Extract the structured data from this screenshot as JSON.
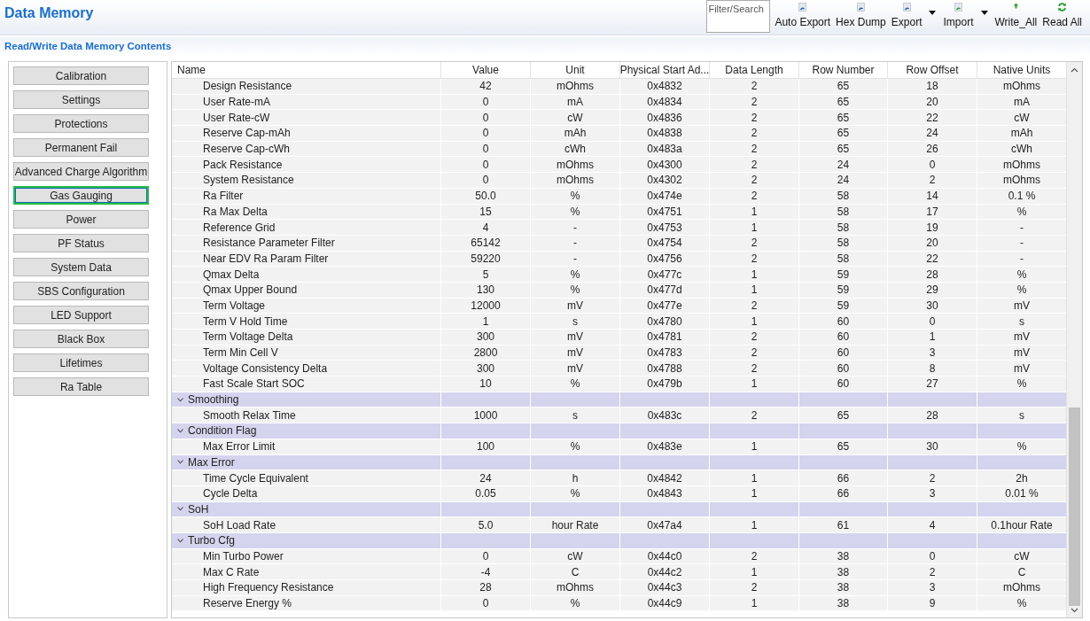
{
  "window": {
    "title": "Data Memory"
  },
  "toolbar": {
    "search": {
      "placeholder": "Filter/Search"
    },
    "buttons": [
      {
        "label": "Auto Export",
        "dropdown": false
      },
      {
        "label": "Hex Dump",
        "dropdown": false
      },
      {
        "label": "Export",
        "dropdown": true
      },
      {
        "label": "Import",
        "dropdown": true
      },
      {
        "label": "Write_All",
        "dropdown": false
      },
      {
        "label": "Read All",
        "dropdown": false
      }
    ]
  },
  "section_title": "Read/Write Data Memory Contents",
  "sidebar": {
    "items": [
      {
        "label": "Calibration",
        "selected": false
      },
      {
        "label": "Settings",
        "selected": false
      },
      {
        "label": "Protections",
        "selected": false
      },
      {
        "label": "Permanent Fail",
        "selected": false
      },
      {
        "label": "Advanced Charge Algorithm",
        "selected": false
      },
      {
        "label": "Gas Gauging",
        "selected": true
      },
      {
        "label": "Power",
        "selected": false
      },
      {
        "label": "PF Status",
        "selected": false
      },
      {
        "label": "System Data",
        "selected": false
      },
      {
        "label": "SBS Configuration",
        "selected": false
      },
      {
        "label": "LED Support",
        "selected": false
      },
      {
        "label": "Black Box",
        "selected": false
      },
      {
        "label": "Lifetimes",
        "selected": false
      },
      {
        "label": "Ra Table",
        "selected": false
      }
    ]
  },
  "table": {
    "columns": [
      "Name",
      "Value",
      "Unit",
      "Physical Start Ad...",
      "Data Length",
      "Row Number",
      "Row Offset",
      "Native Units"
    ],
    "rows": [
      {
        "kind": "item",
        "cells": [
          "Design Resistance",
          "42",
          "mOhms",
          "0x4832",
          "2",
          "65",
          "18",
          "mOhms"
        ]
      },
      {
        "kind": "item",
        "cells": [
          "User Rate-mA",
          "0",
          "mA",
          "0x4834",
          "2",
          "65",
          "20",
          "mA"
        ]
      },
      {
        "kind": "item",
        "cells": [
          "User Rate-cW",
          "0",
          "cW",
          "0x4836",
          "2",
          "65",
          "22",
          "cW"
        ]
      },
      {
        "kind": "item",
        "cells": [
          "Reserve Cap-mAh",
          "0",
          "mAh",
          "0x4838",
          "2",
          "65",
          "24",
          "mAh"
        ]
      },
      {
        "kind": "item",
        "cells": [
          "Reserve Cap-cWh",
          "0",
          "cWh",
          "0x483a",
          "2",
          "65",
          "26",
          "cWh"
        ]
      },
      {
        "kind": "item",
        "cells": [
          "Pack Resistance",
          "0",
          "mOhms",
          "0x4300",
          "2",
          "24",
          "0",
          "mOhms"
        ]
      },
      {
        "kind": "item",
        "cells": [
          "System Resistance",
          "0",
          "mOhms",
          "0x4302",
          "2",
          "24",
          "2",
          "mOhms"
        ]
      },
      {
        "kind": "item",
        "cells": [
          "Ra Filter",
          "50.0",
          "%",
          "0x474e",
          "2",
          "58",
          "14",
          "0.1 %"
        ]
      },
      {
        "kind": "item",
        "cells": [
          "Ra Max Delta",
          "15",
          "%",
          "0x4751",
          "1",
          "58",
          "17",
          "%"
        ]
      },
      {
        "kind": "item",
        "cells": [
          "Reference Grid",
          "4",
          "-",
          "0x4753",
          "1",
          "58",
          "19",
          "-"
        ]
      },
      {
        "kind": "item",
        "cells": [
          "Resistance Parameter Filter",
          "65142",
          "-",
          "0x4754",
          "2",
          "58",
          "20",
          "-"
        ]
      },
      {
        "kind": "item",
        "cells": [
          "Near EDV Ra Param Filter",
          "59220",
          "-",
          "0x4756",
          "2",
          "58",
          "22",
          "-"
        ]
      },
      {
        "kind": "item",
        "cells": [
          "Qmax Delta",
          "5",
          "%",
          "0x477c",
          "1",
          "59",
          "28",
          "%"
        ]
      },
      {
        "kind": "item",
        "cells": [
          "Qmax Upper Bound",
          "130",
          "%",
          "0x477d",
          "1",
          "59",
          "29",
          "%"
        ]
      },
      {
        "kind": "item",
        "cells": [
          "Term Voltage",
          "12000",
          "mV",
          "0x477e",
          "2",
          "59",
          "30",
          "mV"
        ]
      },
      {
        "kind": "item",
        "cells": [
          "Term V Hold Time",
          "1",
          "s",
          "0x4780",
          "1",
          "60",
          "0",
          "s"
        ]
      },
      {
        "kind": "item",
        "cells": [
          "Term Voltage Delta",
          "300",
          "mV",
          "0x4781",
          "2",
          "60",
          "1",
          "mV"
        ]
      },
      {
        "kind": "item",
        "cells": [
          "Term Min Cell V",
          "2800",
          "mV",
          "0x4783",
          "2",
          "60",
          "3",
          "mV"
        ]
      },
      {
        "kind": "item",
        "cells": [
          "Voltage Consistency Delta",
          "300",
          "mV",
          "0x4788",
          "2",
          "60",
          "8",
          "mV"
        ]
      },
      {
        "kind": "item",
        "cells": [
          "Fast Scale Start SOC",
          "10",
          "%",
          "0x479b",
          "1",
          "60",
          "27",
          "%"
        ]
      },
      {
        "kind": "group",
        "label": "Smoothing",
        "expanded": true
      },
      {
        "kind": "item",
        "cells": [
          "Smooth Relax Time",
          "1000",
          "s",
          "0x483c",
          "2",
          "65",
          "28",
          "s"
        ]
      },
      {
        "kind": "group",
        "label": "Condition Flag",
        "expanded": true
      },
      {
        "kind": "item",
        "cells": [
          "Max Error Limit",
          "100",
          "%",
          "0x483e",
          "1",
          "65",
          "30",
          "%"
        ]
      },
      {
        "kind": "group",
        "label": "Max Error",
        "expanded": true
      },
      {
        "kind": "item",
        "cells": [
          "Time Cycle Equivalent",
          "24",
          "h",
          "0x4842",
          "1",
          "66",
          "2",
          "2h"
        ]
      },
      {
        "kind": "item",
        "cells": [
          "Cycle Delta",
          "0.05",
          "%",
          "0x4843",
          "1",
          "66",
          "3",
          "0.01 %"
        ]
      },
      {
        "kind": "group",
        "label": "SoH",
        "expanded": true
      },
      {
        "kind": "item",
        "cells": [
          "SoH Load Rate",
          "5.0",
          "hour Rate",
          "0x47a4",
          "1",
          "61",
          "4",
          "0.1hour Rate"
        ]
      },
      {
        "kind": "group",
        "label": "Turbo Cfg",
        "expanded": true
      },
      {
        "kind": "item",
        "cells": [
          "Min Turbo Power",
          "0",
          "cW",
          "0x44c0",
          "2",
          "38",
          "0",
          "cW"
        ]
      },
      {
        "kind": "item",
        "cells": [
          "Max C Rate",
          "-4",
          "C",
          "0x44c2",
          "1",
          "38",
          "2",
          "C"
        ]
      },
      {
        "kind": "item",
        "cells": [
          "High Frequency Resistance",
          "28",
          "mOhms",
          "0x44c3",
          "2",
          "38",
          "3",
          "mOhms"
        ]
      },
      {
        "kind": "item",
        "cells": [
          "Reserve Energy %",
          "0",
          "%",
          "0x44c9",
          "1",
          "38",
          "9",
          "%"
        ]
      }
    ]
  }
}
